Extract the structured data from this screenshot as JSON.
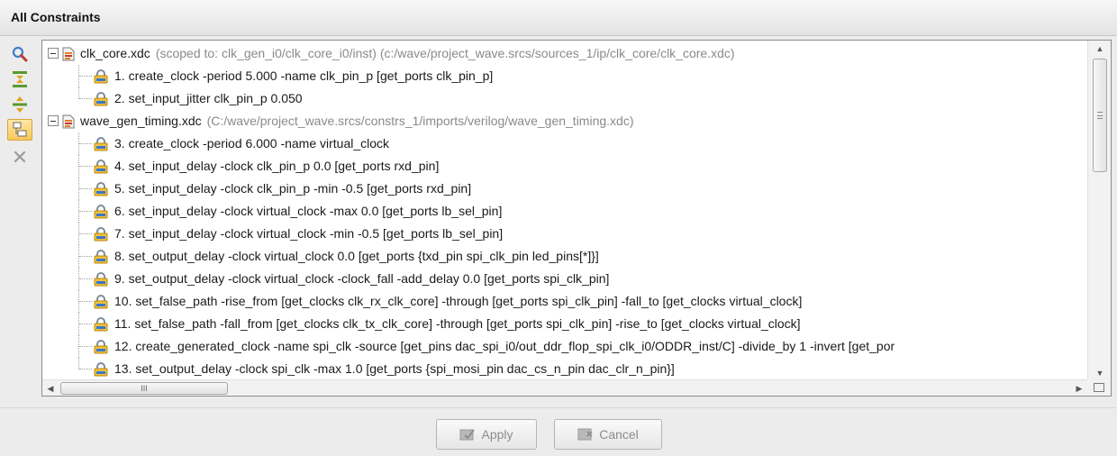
{
  "panel": {
    "title": "All Constraints"
  },
  "toolbar": {
    "buttons": [
      {
        "icon": "search-icon"
      },
      {
        "icon": "collapse-all-icon"
      },
      {
        "icon": "expand-all-icon"
      },
      {
        "icon": "group-by-file-icon",
        "active": true
      },
      {
        "icon": "delete-icon"
      }
    ]
  },
  "tree": {
    "files": [
      {
        "name": "clk_core.xdc",
        "path": "(scoped to: clk_gen_i0/clk_core_i0/inst) (c:/wave/project_wave.srcs/sources_1/ip/clk_core/clk_core.xdc)",
        "constraints": [
          "1. create_clock -period 5.000 -name clk_pin_p [get_ports clk_pin_p]",
          "2. set_input_jitter clk_pin_p 0.050"
        ]
      },
      {
        "name": "wave_gen_timing.xdc",
        "path": "(C:/wave/project_wave.srcs/constrs_1/imports/verilog/wave_gen_timing.xdc)",
        "constraints": [
          "3. create_clock -period 6.000 -name virtual_clock",
          "4. set_input_delay -clock clk_pin_p 0.0 [get_ports rxd_pin]",
          "5. set_input_delay -clock clk_pin_p -min -0.5 [get_ports rxd_pin]",
          "6. set_input_delay -clock virtual_clock -max 0.0 [get_ports lb_sel_pin]",
          "7. set_input_delay -clock virtual_clock -min -0.5 [get_ports lb_sel_pin]",
          "8. set_output_delay -clock virtual_clock 0.0 [get_ports {txd_pin spi_clk_pin led_pins[*]}]",
          "9. set_output_delay -clock virtual_clock -clock_fall -add_delay 0.0 [get_ports spi_clk_pin]",
          "10. set_false_path -rise_from [get_clocks clk_rx_clk_core] -through [get_ports spi_clk_pin] -fall_to [get_clocks virtual_clock]",
          "11. set_false_path -fall_from [get_clocks clk_tx_clk_core] -through [get_ports spi_clk_pin] -rise_to [get_clocks virtual_clock]",
          "12. create_generated_clock -name spi_clk -source [get_pins dac_spi_i0/out_ddr_flop_spi_clk_i0/ODDR_inst/C] -divide_by 1 -invert [get_por",
          "13. set_output_delay -clock spi_clk -max 1.0 [get_ports {spi_mosi_pin dac_cs_n_pin dac_clr_n_pin}]"
        ]
      }
    ]
  },
  "scrollbars": {
    "horizontal_thumb_label": "III"
  },
  "actions": {
    "apply_label": "Apply",
    "cancel_label": "Cancel"
  },
  "colors": {
    "path_gray": "#8a8a8a",
    "disabled_text": "#8c8c8c",
    "active_tool": "#f7c85a"
  }
}
